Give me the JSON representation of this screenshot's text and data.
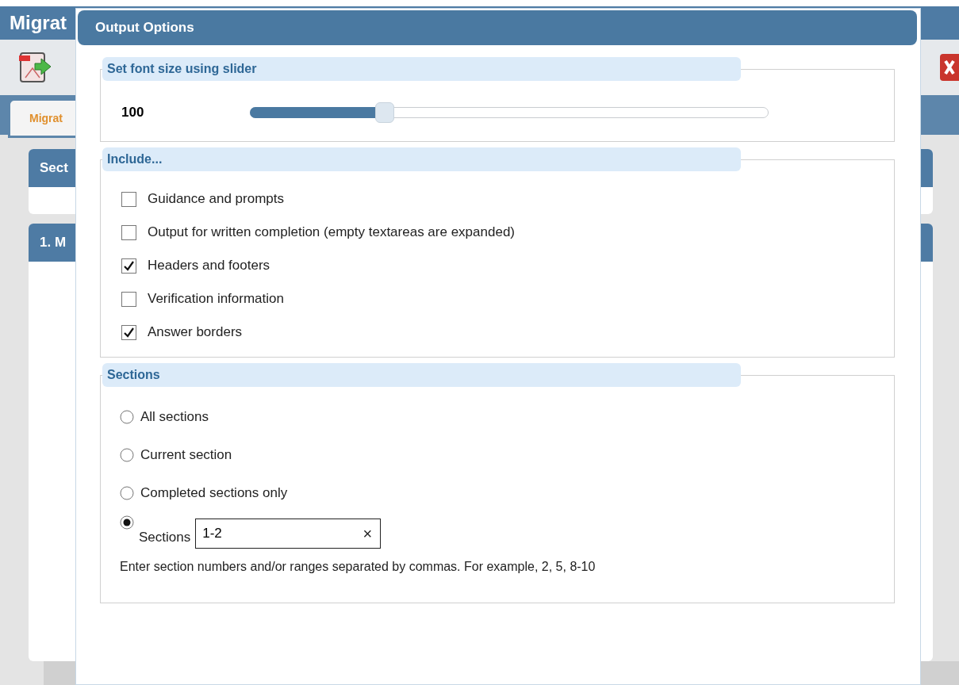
{
  "app": {
    "title": "Migrat",
    "tab": {
      "label": "Migrat",
      "selected": true
    },
    "panels": [
      {
        "title": "Sect"
      },
      {
        "title": "1. M"
      }
    ]
  },
  "dialog": {
    "title": "Output Options",
    "font_size": {
      "legend": "Set font size using slider",
      "value": "100",
      "level": 0.26
    },
    "include": {
      "legend": "Include...",
      "options": [
        {
          "label": "Guidance and prompts",
          "checked": false
        },
        {
          "label": "Output for written completion (empty textareas are expanded)",
          "checked": false
        },
        {
          "label": "Headers and footers",
          "checked": true
        },
        {
          "label": "Verification information",
          "checked": false
        },
        {
          "label": "Answer borders",
          "checked": true
        }
      ]
    },
    "sections": {
      "legend": "Sections",
      "options": [
        {
          "label": "All sections",
          "selected": false,
          "kind": "plain"
        },
        {
          "label": "Current section",
          "selected": false,
          "kind": "plain"
        },
        {
          "label": "Completed sections only",
          "selected": false,
          "kind": "plain"
        },
        {
          "label": "Sections",
          "selected": true,
          "kind": "range"
        }
      ],
      "range_value": "1-2",
      "clear": "×",
      "hint": "Enter section numbers and/or ranges separated by commas. For example, 2, 5, 8-10"
    }
  }
}
